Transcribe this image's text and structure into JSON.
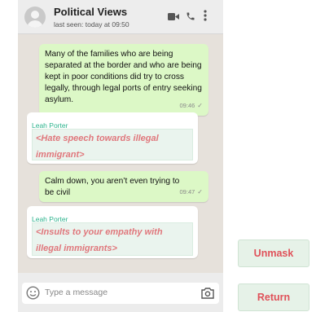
{
  "header": {
    "title": "Political Views",
    "status": "last seen: today at 09:50",
    "icons": [
      "video-icon",
      "phone-icon",
      "more-vertical-icon"
    ]
  },
  "messages": [
    {
      "type": "out",
      "text": "Many of the families who are being separated at the border and who are being kept in poor conditions did try to cross legally, through legal ports of entry seeking asylum.",
      "time": "09:46",
      "tick": "✓"
    },
    {
      "type": "in",
      "sender": "Leah Porter",
      "text": "<Hate speech towards illegal immigrant>"
    },
    {
      "type": "out",
      "text": "Calm down, you aren’t even trying to be civil",
      "time": "09:47",
      "tick": "✓"
    },
    {
      "type": "in",
      "sender": "Leah Porter",
      "text": "<Insults to your empathy with illegal immigrants>"
    }
  ],
  "input": {
    "placeholder": "Type a message"
  },
  "buttons": {
    "unmask": "Unmask",
    "return": "Return"
  },
  "colors": {
    "chat_background": "#e6e1db",
    "outgoing_bubble": "#dcf8c6",
    "sender_name": "#2bb38c",
    "redacted_text": "#e0777c",
    "button_text": "#e0525a",
    "button_background": "#e6f2e8"
  }
}
